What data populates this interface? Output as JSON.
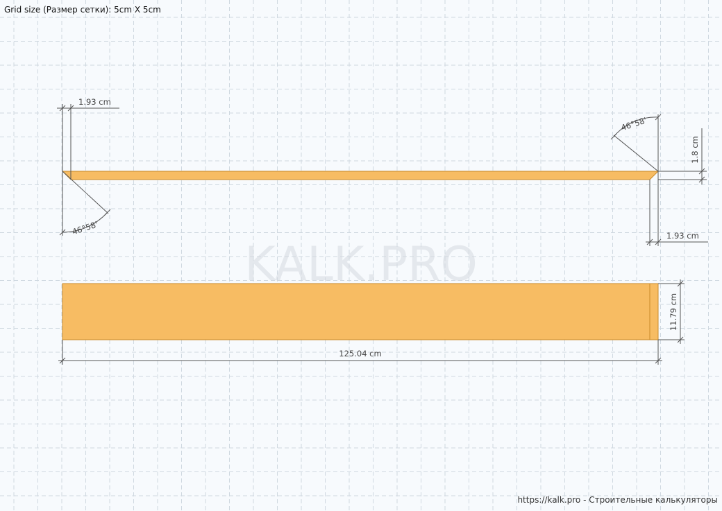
{
  "header": {
    "grid_info": "Grid size (Размер сетки): 5cm X 5cm"
  },
  "watermark": "KALK.PRO",
  "footer": {
    "text": "https://kalk.pro - Строительные калькуляторы"
  },
  "colors": {
    "board_fill": "#f7bc63",
    "board_stroke": "#c98a2a",
    "dimension_line": "#555555",
    "grid_line": "#cfd8e0",
    "background": "#f7fafd"
  },
  "side_view": {
    "top_left_offset": "1.93 cm",
    "left_angle": "46°58'",
    "right_angle": "46°58'",
    "thickness": "1.8 cm",
    "bottom_right_offset": "1.93 cm"
  },
  "top_view": {
    "width": "11.79 cm",
    "length": "125.04 cm"
  }
}
